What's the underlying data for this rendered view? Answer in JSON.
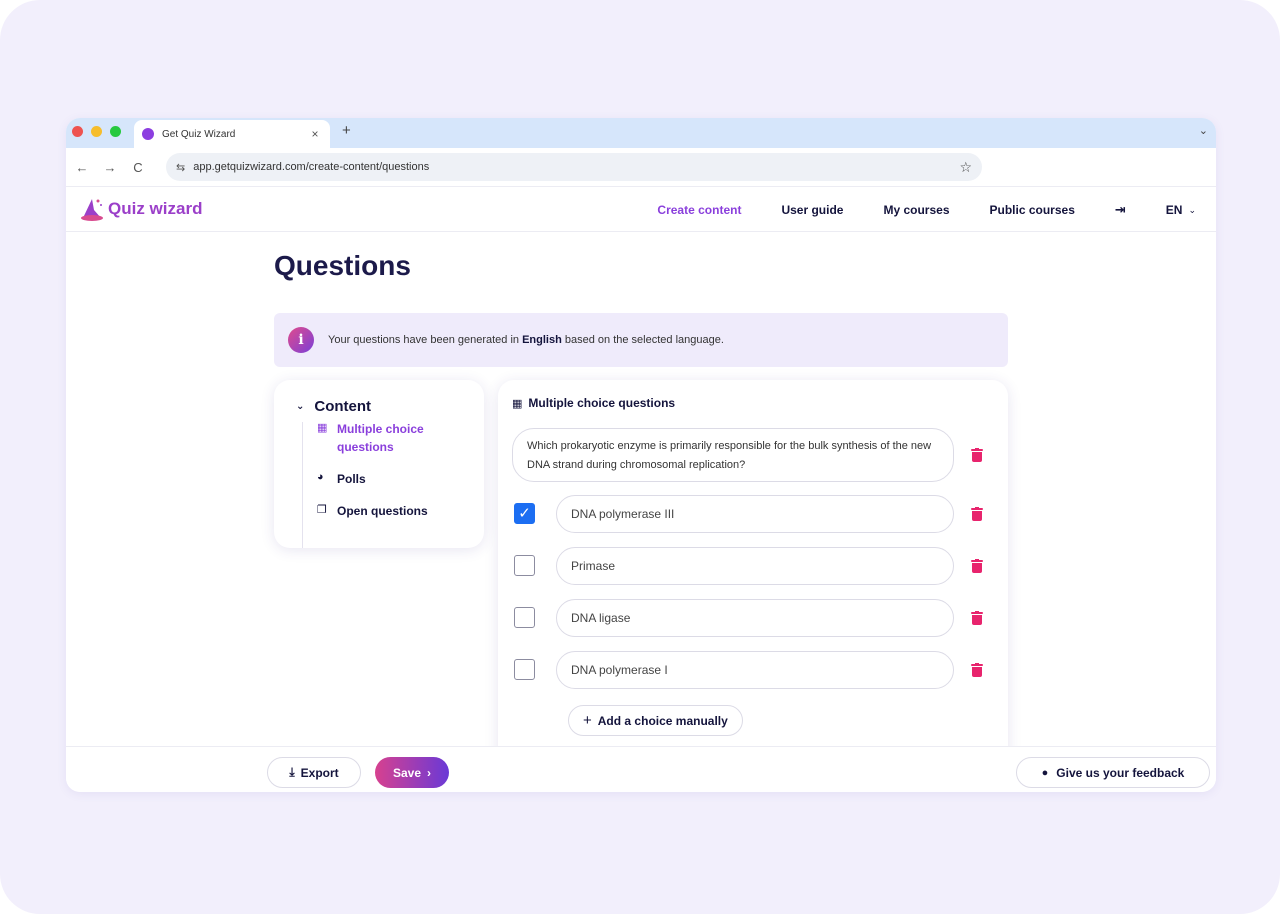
{
  "browser": {
    "tab_title": "Get Quiz Wizard",
    "tab_close": "×",
    "new_tab": "+",
    "tabstrip_menu": "⌄",
    "back": "←",
    "forward": "→",
    "reload": "C",
    "url": "app.getquizwizard.com/create-content/questions",
    "site_info_icon": "⇆",
    "bookmark": "☆"
  },
  "header": {
    "logo_text": "Quiz wizard",
    "nav": [
      {
        "label": "Create content",
        "active": true
      },
      {
        "label": "User guide"
      },
      {
        "label": "My courses"
      },
      {
        "label": "Public courses"
      }
    ],
    "logout_icon": "⇥",
    "language": "EN",
    "language_chevron": "⌄"
  },
  "page": {
    "title": "Questions",
    "info_icon": "i",
    "info_prefix": "Your questions have been generated in ",
    "info_language": "English",
    "info_suffix": " based on the selected language."
  },
  "sidebar": {
    "header": "Content",
    "chevron": "⌄",
    "items": [
      {
        "label": "Multiple choice questions",
        "icon": "▦",
        "active": true
      },
      {
        "label": "Polls",
        "icon": "◕"
      },
      {
        "label": "Open questions",
        "icon": "❐"
      }
    ]
  },
  "question_card": {
    "header_icon": "▦",
    "header": "Multiple choice questions",
    "question": "Which prokaryotic enzyme is primarily responsible for the bulk synthesis of the new DNA strand during chromosomal replication?",
    "choices": [
      {
        "label": "DNA polymerase III",
        "checked": true,
        "check_mark": "✓"
      },
      {
        "label": "Primase",
        "checked": false
      },
      {
        "label": "DNA ligase",
        "checked": false
      },
      {
        "label": "DNA polymerase I",
        "checked": false
      }
    ],
    "add_choice_icon": "+",
    "add_choice": "Add a choice manually"
  },
  "footer": {
    "export_icon": "⤓",
    "export": "Export",
    "save": "Save",
    "save_chevron": "›",
    "feedback_icon": "●",
    "feedback": "Give us your feedback"
  },
  "colors": {
    "accent": "#8a3fdc",
    "danger": "#e8246d",
    "checkbox": "#1c6ef2",
    "background": "#f2effc"
  }
}
